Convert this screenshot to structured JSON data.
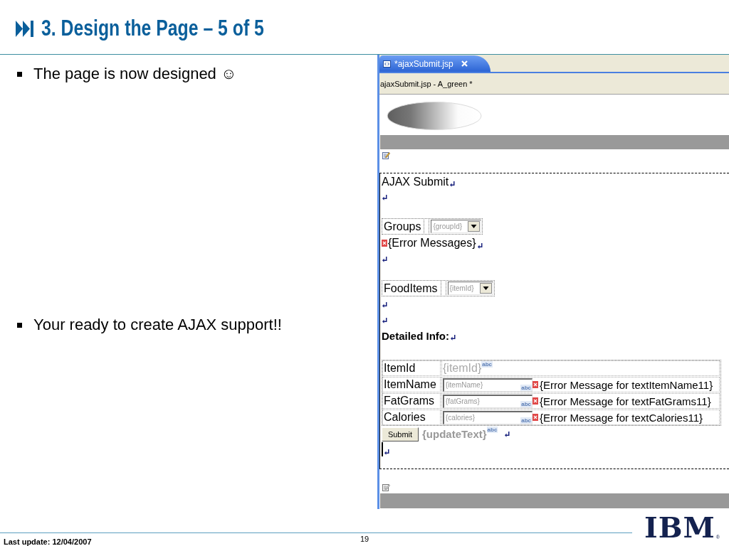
{
  "title": {
    "text": "3. Design the Page – 5 of 5"
  },
  "bullets": [
    {
      "text": "The page is now designed ☺"
    },
    {
      "text": "Your ready to create AJAX support!!"
    }
  ],
  "editor": {
    "tabs": [
      {
        "label": "*ajaxSubmit.jsp",
        "selected": true
      }
    ],
    "header": "ajaxSubmit.jsp - A_green *",
    "lines": [
      {
        "kind": "text",
        "text": "AJAX Submit",
        "return_mark": true
      },
      {
        "kind": "break",
        "return_mark": true
      },
      {
        "kind": "select",
        "label": "Groups",
        "binding": "{groupId}"
      },
      {
        "kind": "error",
        "text": "{Error Messages}",
        "return_mark": true
      },
      {
        "kind": "break",
        "return_mark": true
      },
      {
        "kind": "select",
        "label": "FoodItems",
        "binding": "{itemId}"
      },
      {
        "kind": "break",
        "return_mark": true
      },
      {
        "kind": "break",
        "return_mark": true
      },
      {
        "kind": "heading",
        "text": "Detailed Info:",
        "return_mark": true
      }
    ],
    "table": {
      "rows": [
        {
          "kind": "output",
          "label": "ItemId",
          "binding": "{itemId}",
          "badge": "abc"
        },
        {
          "kind": "input",
          "label": "ItemName",
          "binding": "{itemName}",
          "badge": "abc",
          "error": "{Error Message for textItemName11}"
        },
        {
          "kind": "input",
          "label": "FatGrams",
          "binding": "{fatGrams}",
          "badge": "abc",
          "error": "{Error Message for textFatGrams11}"
        },
        {
          "kind": "input",
          "label": "Calories",
          "binding": "{calories}",
          "badge": "abc",
          "error": "{Error Message for textCalories11}"
        }
      ]
    },
    "submit": {
      "button": "Submit",
      "binding": "{updateText}",
      "badge": "abc",
      "return_mark": true
    },
    "cursor_line": {
      "cursor": true,
      "return_mark": true
    }
  },
  "footer": {
    "last_update": "Last update: 12/04/2007",
    "page": "19",
    "logo": "IBM",
    "logo_mark": "®"
  }
}
